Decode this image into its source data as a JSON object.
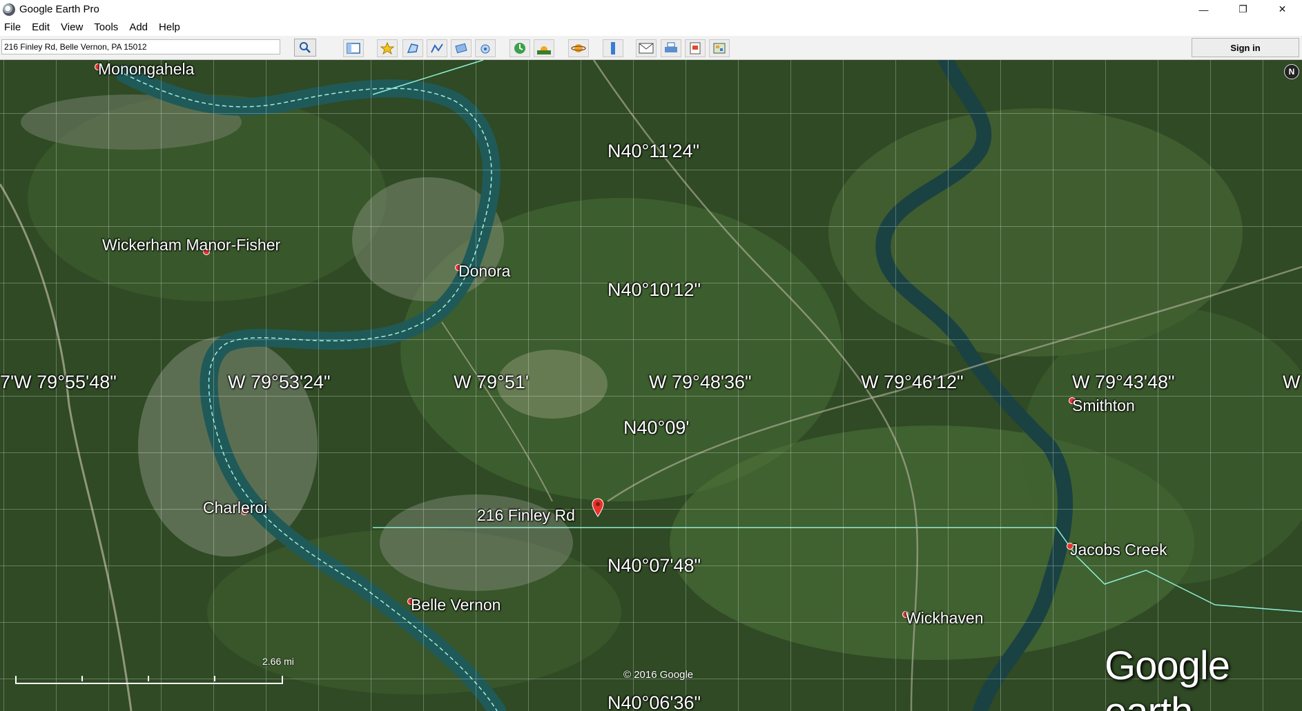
{
  "window": {
    "title": "Google Earth Pro",
    "minimize": "—",
    "restore": "❐",
    "close": "✕"
  },
  "menu": [
    "File",
    "Edit",
    "View",
    "Tools",
    "Add",
    "Help"
  ],
  "search": {
    "value": "216 Finley Rd, Belle Vernon, PA 15012"
  },
  "toolbar": {
    "icons": [
      "sidebar-icon",
      "placemark-icon",
      "polygon-icon",
      "path-icon",
      "image-overlay-icon",
      "record-tour-icon",
      "historical-imagery-icon",
      "sunlight-icon",
      "planets-icon",
      "ruler-icon",
      "email-icon",
      "print-icon",
      "save-image-icon",
      "view-in-maps-icon"
    ],
    "sign_in": "Sign in"
  },
  "map": {
    "latitudes": [
      "N40°11'24\"",
      "N40°10'12\"",
      "N40°09'",
      "N40°07'48\"",
      "N40°06'36\""
    ],
    "longitudes": [
      "7'W 79°55'48\"",
      "W 79°53'24\"",
      "W 79°51'",
      "W 79°48'36\"",
      "W 79°46'12\"",
      "W 79°43'48\"",
      "W"
    ],
    "places": [
      "Monongahela",
      "Wickerham Manor-Fisher",
      "Donora",
      "Charleroi",
      "216 Finley Rd",
      "Belle Vernon",
      "Smithton",
      "Jacobs Creek",
      "Wickhaven"
    ],
    "compass": "N",
    "scale": "2.66 mi",
    "copyright": "© 2016 Google",
    "logo": "Google earth"
  }
}
